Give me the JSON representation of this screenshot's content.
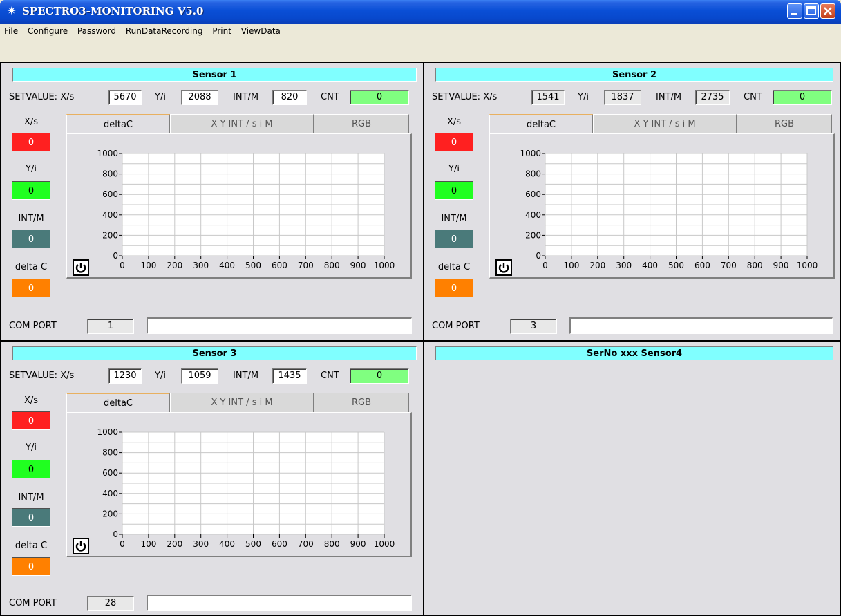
{
  "window": {
    "title": "SPECTRO3-MONITORING V5.0",
    "icon": "sun-icon"
  },
  "menu": [
    "File",
    "Configure",
    "Password",
    "RunDataRecording",
    "Print",
    "ViewData"
  ],
  "common": {
    "setvalue_label": "SETVALUE: X/s",
    "yi_label": "Y/i",
    "intm_label": "INT/M",
    "cnt_label": "CNT",
    "ind_labels": [
      "X/s",
      "Y/i",
      "INT/M",
      "delta C"
    ],
    "tabs": [
      "deltaC",
      "X Y INT / s i M",
      "RGB"
    ],
    "com_label": "COM PORT",
    "y_ticks": [
      "1000",
      "800",
      "600",
      "400",
      "200",
      "0"
    ],
    "x_ticks": [
      "0",
      "100",
      "200",
      "300",
      "400",
      "500",
      "600",
      "700",
      "800",
      "900",
      "1000"
    ]
  },
  "sensors": [
    {
      "title": "Sensor 1",
      "x": "5670",
      "y": "2088",
      "intm": "820",
      "cnt": "0",
      "indicators": [
        "0",
        "0",
        "0",
        "0"
      ],
      "com_port": "1",
      "message": ""
    },
    {
      "title": "Sensor 2",
      "x": "1541",
      "y": "1837",
      "intm": "2735",
      "cnt": "0",
      "indicators": [
        "0",
        "0",
        "0",
        "0"
      ],
      "com_port": "3",
      "message": ""
    },
    {
      "title": "Sensor 3",
      "x": "1230",
      "y": "1059",
      "intm": "1435",
      "cnt": "0",
      "indicators": [
        "0",
        "0",
        "0",
        "0"
      ],
      "com_port": "28",
      "message": ""
    },
    {
      "title": "SerNo xxx Sensor4"
    }
  ],
  "chart_data": {
    "type": "line",
    "title": "",
    "xlabel": "",
    "ylabel": "",
    "xlim": [
      0,
      1000
    ],
    "ylim": [
      0,
      1000
    ],
    "grid": true,
    "series": []
  },
  "colors": {
    "title_bg": "#80ffff",
    "cnt_bg": "#80ff80",
    "x_ind": "#ff2020",
    "y_ind": "#20ff20",
    "int_ind": "#4a7a7a",
    "dc_ind": "#ff8000"
  }
}
